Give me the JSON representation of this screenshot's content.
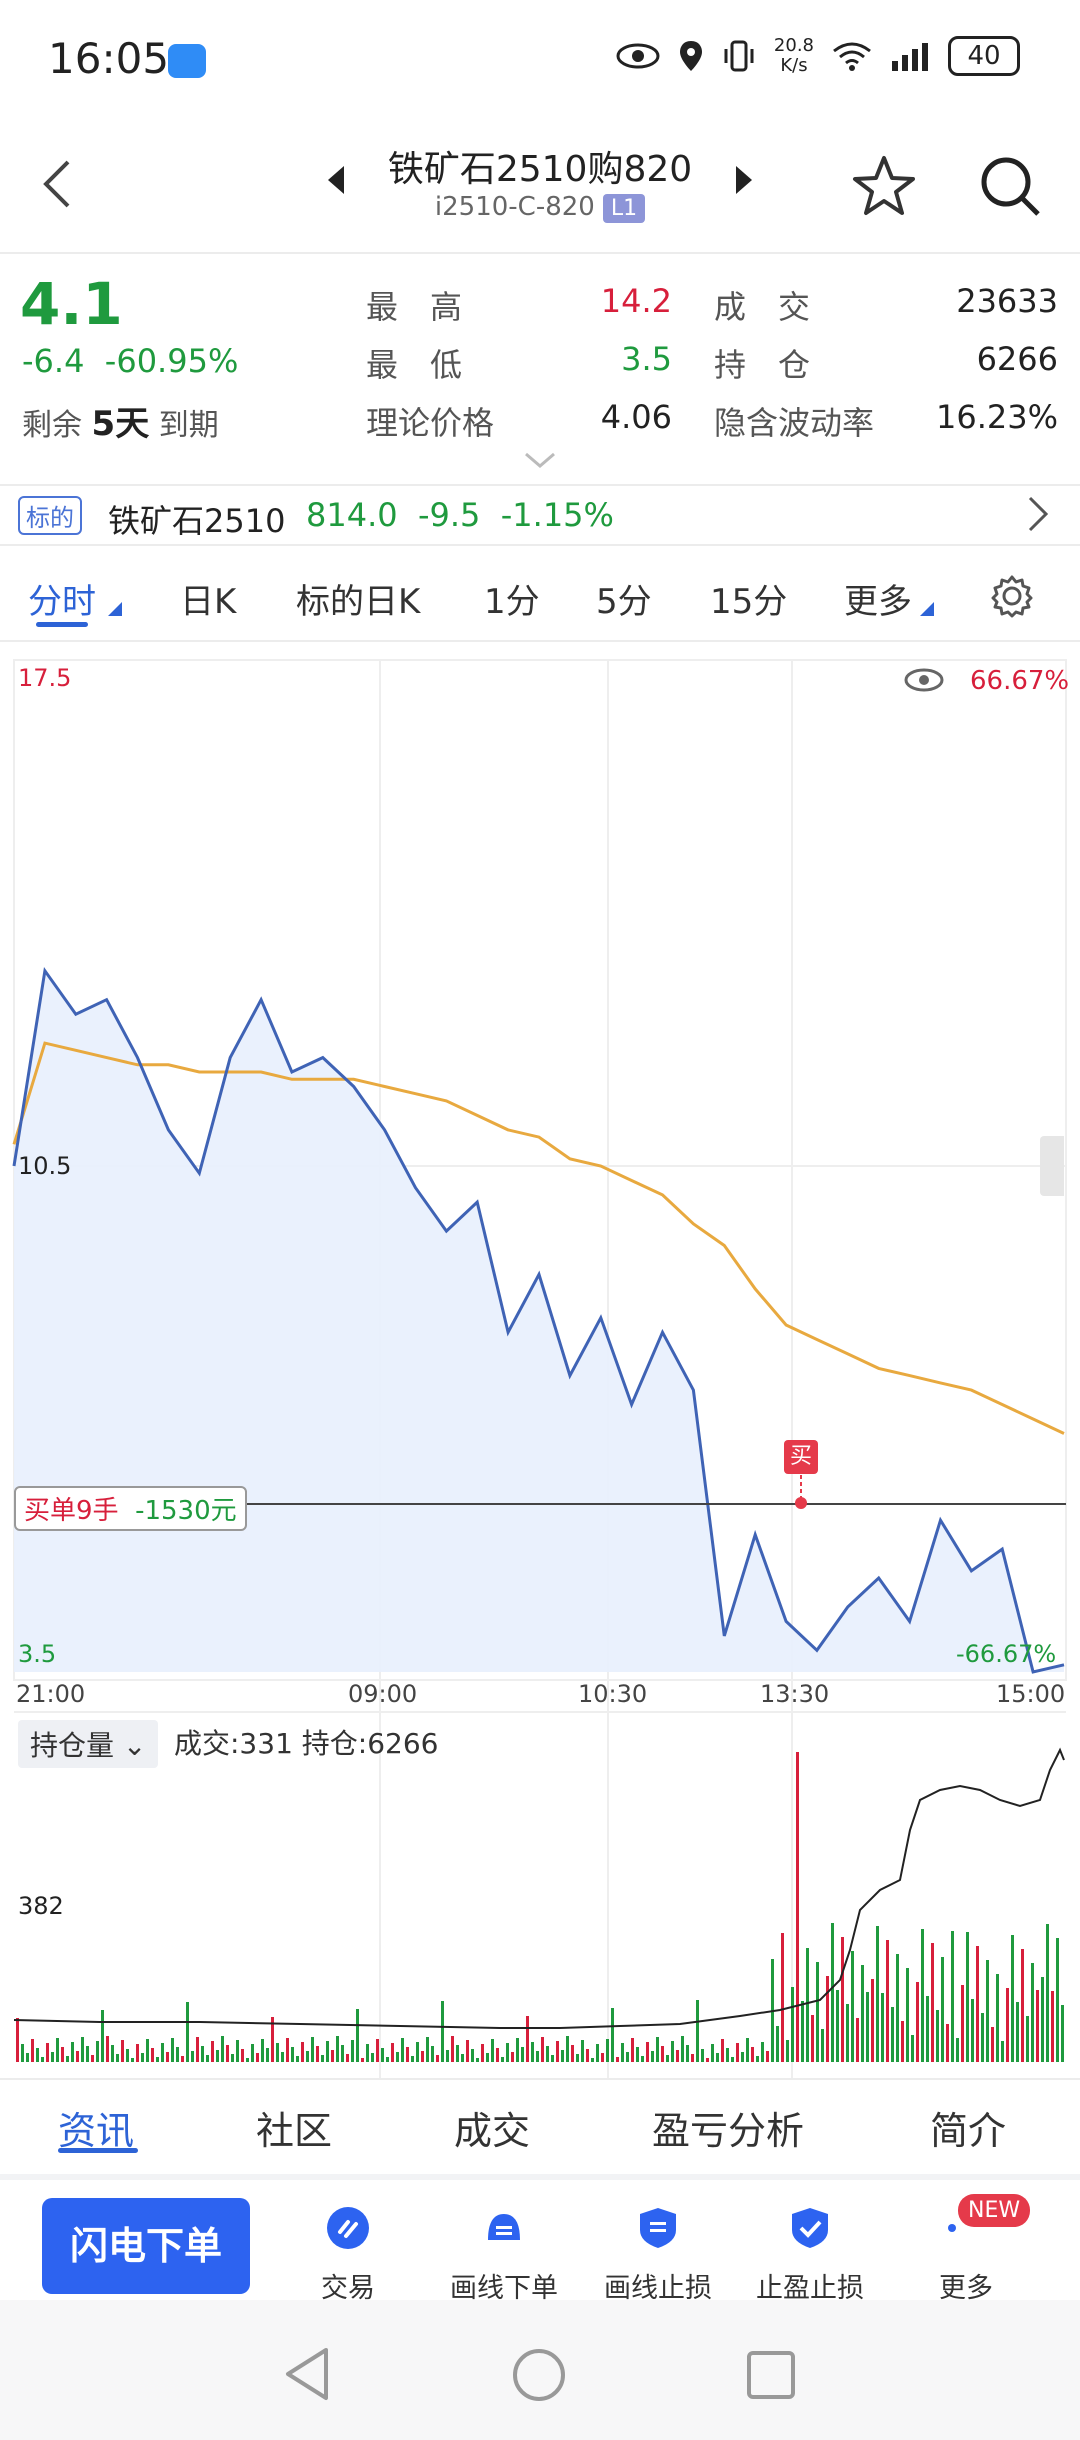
{
  "status_bar": {
    "time": "16:05",
    "net_speed_top": "20.8",
    "net_speed_bottom": "K/s",
    "signal_extra": "6",
    "battery": "40"
  },
  "header": {
    "title": "铁矿石2510购820",
    "code": "i2510-C-820",
    "level_badge": "L1"
  },
  "quote": {
    "price": "4.1",
    "change": "-6.4",
    "change_pct": "-60.95%",
    "remaining_prefix": "剩余",
    "remaining_days": "5天",
    "remaining_suffix": "到期",
    "high_label": "最　高",
    "high_value": "14.2",
    "low_label": "最　低",
    "low_value": "3.5",
    "theory_label": "理论价格",
    "theory_value": "4.06",
    "volume_label": "成　交",
    "volume_value": "23633",
    "oi_label": "持　仓",
    "oi_value": "6266",
    "iv_label": "隐含波动率",
    "iv_value": "16.23%"
  },
  "underlying": {
    "tag": "标的",
    "name": "铁矿石2510",
    "price": "814.0",
    "change": "-9.5",
    "change_pct": "-1.15%"
  },
  "tabs": [
    {
      "label": "分时"
    },
    {
      "label": "日K"
    },
    {
      "label": "标的日K"
    },
    {
      "label": "1分"
    },
    {
      "label": "5分"
    },
    {
      "label": "15分"
    },
    {
      "label": "更多"
    }
  ],
  "chart": {
    "y_top": "17.5",
    "y_mid": "10.5",
    "y_bottom": "3.5",
    "pct_top": "66.67%",
    "pct_bottom": "-66.67%",
    "x_labels": [
      "21:00",
      "09:00",
      "10:30",
      "13:30",
      "15:00"
    ],
    "trade_label": "买单9手",
    "trade_pnl": "-1530元",
    "buy_marker": "买",
    "colors": {
      "price_line": "#3f63b5",
      "avg_line": "#e8a93f",
      "fill": "#e8f0fd",
      "up": "#d71f3b",
      "down": "#1f9a3e"
    }
  },
  "chart_data": {
    "type": "line",
    "title": "",
    "xlabel": "",
    "ylabel": "",
    "x": [
      "21:00",
      "09:00",
      "10:30",
      "13:30",
      "15:00"
    ],
    "ylim": [
      3.5,
      17.5
    ],
    "series": [
      {
        "values": [
          10.5,
          13.2,
          12.6,
          12.8,
          12.0,
          11.0,
          10.4,
          12.0,
          12.8,
          11.8,
          12.0,
          11.6,
          11.0,
          10.2,
          9.6,
          10.0,
          8.2,
          9.0,
          7.6,
          8.4,
          7.2,
          8.2,
          7.4,
          4.0,
          5.4,
          4.2,
          3.8,
          4.4,
          4.8,
          4.2,
          5.6,
          4.9,
          5.2,
          3.5,
          3.6
        ]
      },
      {
        "values": [
          10.8,
          12.2,
          12.1,
          12.0,
          11.9,
          11.9,
          11.8,
          11.8,
          11.8,
          11.7,
          11.7,
          11.7,
          11.6,
          11.5,
          11.4,
          11.2,
          11.0,
          10.9,
          10.6,
          10.5,
          10.3,
          10.1,
          9.7,
          9.4,
          8.8,
          8.3,
          8.1,
          7.9,
          7.7,
          7.6,
          7.5,
          7.4,
          7.2,
          7.0,
          6.8
        ]
      }
    ]
  },
  "volume": {
    "selector": "持仓量",
    "info": "成交:331 持仓:6266",
    "y_label": "382"
  },
  "bottom_tabs": [
    {
      "label": "资讯"
    },
    {
      "label": "社区"
    },
    {
      "label": "成交"
    },
    {
      "label": "盈亏分析"
    },
    {
      "label": "简介"
    }
  ],
  "actions": {
    "flash_order": "闪电下单",
    "items": [
      {
        "label": "交易",
        "icon": "trade-icon"
      },
      {
        "label": "画线下单",
        "icon": "draw-order-icon"
      },
      {
        "label": "画线止损",
        "icon": "draw-stop-icon"
      },
      {
        "label": "止盈止损",
        "icon": "shield-icon"
      },
      {
        "label": "更多",
        "icon": "more-icon"
      }
    ],
    "new_badge": "NEW"
  }
}
